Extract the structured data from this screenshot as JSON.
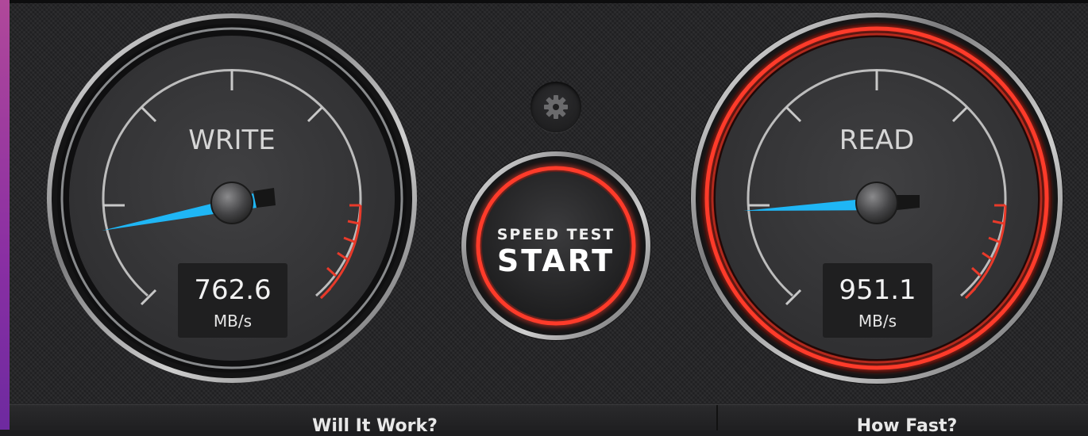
{
  "write_gauge": {
    "label": "WRITE",
    "value": "762.6",
    "unit": "MB/s"
  },
  "read_gauge": {
    "label": "READ",
    "value": "951.1",
    "unit": "MB/s"
  },
  "start_button": {
    "caption": "SPEED TEST",
    "label": "START"
  },
  "settings_button": {
    "icon": "gear-icon"
  },
  "footer": {
    "left_title": "Will It Work?",
    "right_title": "How Fast?"
  },
  "colors": {
    "needle": "#1fb6f5",
    "redline": "#e83a2a",
    "accent_red": "#ff3b2a",
    "dial": "#3a3a3c"
  }
}
